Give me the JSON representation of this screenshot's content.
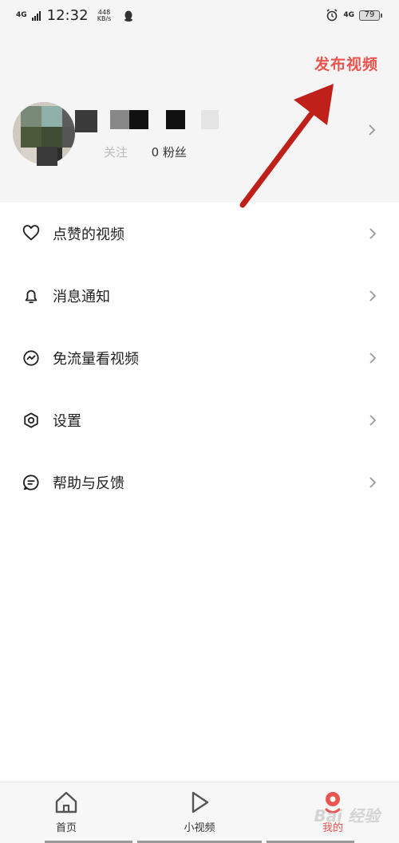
{
  "status_bar": {
    "network": "4G",
    "time": "12:32",
    "speed": "448 KB/s",
    "right_network": "4G",
    "battery": "79"
  },
  "header": {
    "publish_label": "发布视频",
    "following_label": "关注",
    "followers_count": "0",
    "followers_label": "粉丝"
  },
  "menu": [
    {
      "label": "点赞的视频",
      "icon": "heart-icon"
    },
    {
      "label": "消息通知",
      "icon": "bell-icon"
    },
    {
      "label": "免流量看视频",
      "icon": "data-free-icon"
    },
    {
      "label": "设置",
      "icon": "settings-icon"
    },
    {
      "label": "帮助与反馈",
      "icon": "feedback-icon"
    }
  ],
  "bottom_nav": [
    {
      "label": "首页",
      "icon": "home-icon"
    },
    {
      "label": "小视频",
      "icon": "play-icon"
    },
    {
      "label": "我的",
      "icon": "profile-icon"
    }
  ],
  "watermark": "Bai 经验",
  "colors": {
    "accent": "#e8554e",
    "arrow": "#c0201a",
    "background": "#f5f5f5"
  }
}
